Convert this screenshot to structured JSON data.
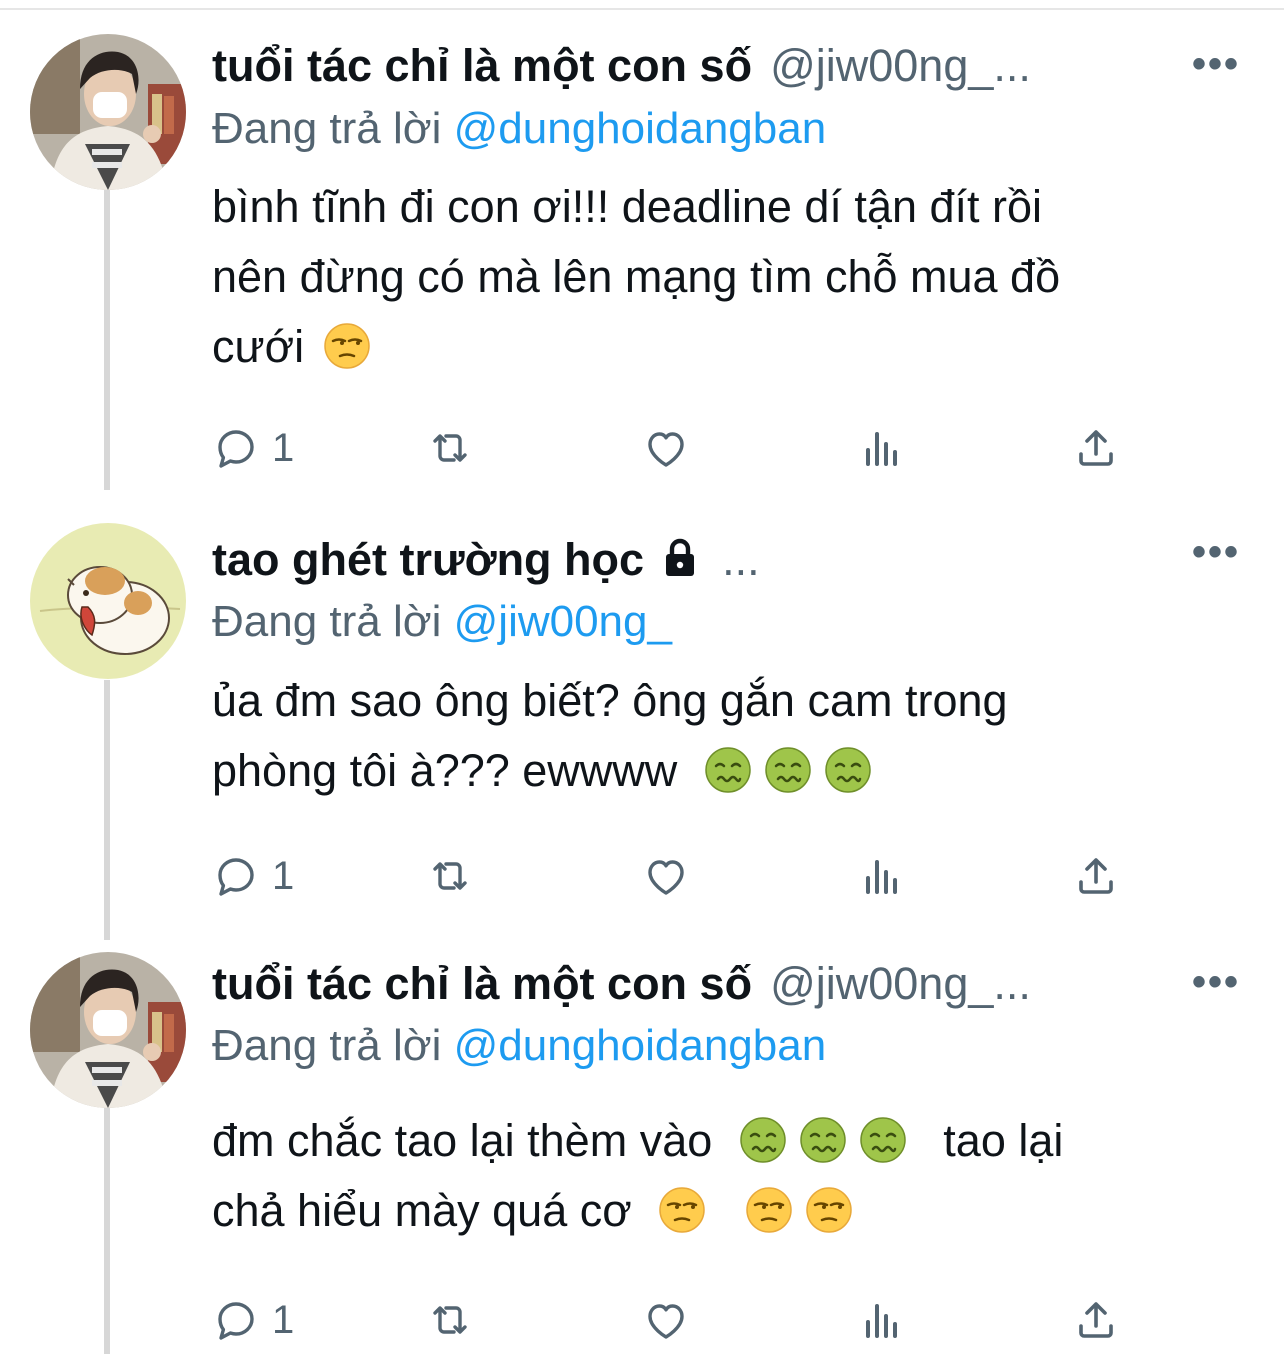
{
  "tweets": [
    {
      "display_name": "tuổi tác chỉ là một con số",
      "handle": "@jiw00ng_...",
      "replying_label": "Đang trả lời",
      "replying_to": "@dunghoidangban",
      "lines": [
        "bình tĩnh đi con ơi!!! deadline dí tận đít rồi",
        "nên đừng có mà lên mạng tìm chỗ mua đồ",
        "cưới"
      ],
      "reply_count": "1",
      "avatar": "person-in-mask-photo"
    },
    {
      "display_name": "tao ghét trường học",
      "handle": "...",
      "replying_label": "Đang trả lời",
      "replying_to": "@jiw00ng_",
      "lines": [
        "ủa đm sao ông biết? ông gắn cam trong",
        "phòng tôi à??? ewwww"
      ],
      "reply_count": "1",
      "avatar": "hamster-cartoon"
    },
    {
      "display_name": "tuổi tác chỉ là một con số",
      "handle": "@jiw00ng_...",
      "replying_label": "Đang trả lời",
      "replying_to": "@dunghoidangban",
      "lines": [
        "đm chắc tao lại thèm vào",
        "tao lại",
        "chả hiểu mày quá cơ"
      ],
      "reply_count": "1",
      "avatar": "person-in-mask-photo"
    }
  ],
  "more_icon": "more-dots-icon",
  "icons": [
    "reply-icon",
    "retweet-icon",
    "like-icon",
    "analytics-icon",
    "share-icon",
    "lock-icon",
    "unamused-face-emoji",
    "nauseated-face-emoji"
  ],
  "colors": {
    "mention": "#1d9bf0",
    "secondary": "#536471",
    "text": "#0f1419",
    "thread_line": "#d7d7d7"
  }
}
